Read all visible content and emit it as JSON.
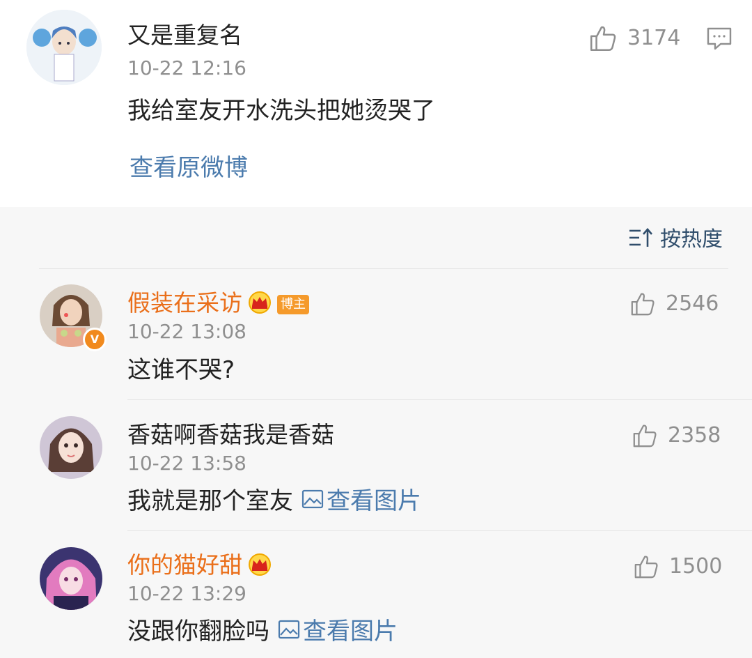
{
  "post": {
    "author": "又是重复名",
    "time": "10-22 12:16",
    "text": "我给室友开水洗头把她烫哭了",
    "likes": "3174",
    "view_original": "查看原微博"
  },
  "sort": {
    "label": "按热度"
  },
  "comments": [
    {
      "author": "假装在采访",
      "badge": "博主",
      "time": "10-22 13:08",
      "text": "这谁不哭?",
      "likes": "2546"
    },
    {
      "author": "香菇啊香菇我是香菇",
      "time": "10-22 13:58",
      "text": "我就是那个室友",
      "image_link": "查看图片",
      "likes": "2358"
    },
    {
      "author": "你的猫好甜",
      "time": "10-22 13:29",
      "text": "没跟你翻脸吗",
      "image_link": "查看图片",
      "likes": "1500"
    }
  ],
  "colors": {
    "accent_orange": "#ea6f1a",
    "link_blue": "#4b7bad",
    "badge_orange": "#f59a2b"
  },
  "icons": [
    "thumbs-up-icon",
    "comment-icon",
    "sort-icon",
    "crown-icon",
    "image-icon",
    "verified-v-icon"
  ]
}
